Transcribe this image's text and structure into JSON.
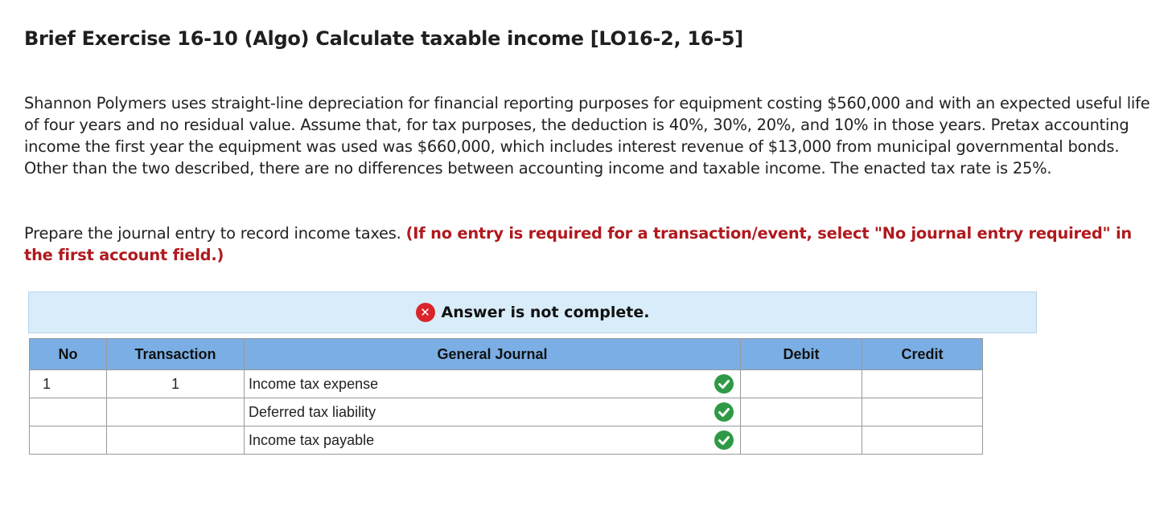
{
  "title": "Brief Exercise 16-10 (Algo) Calculate taxable income [LO16-2, 16-5]",
  "problem_text": "Shannon Polymers uses straight-line depreciation for financial reporting purposes for equipment costing $560,000 and with an expected useful life of four years and no residual value. Assume that, for tax purposes, the deduction is 40%, 30%, 20%, and 10% in those years. Pretax accounting income the first year the equipment was used was $660,000, which includes interest revenue of $13,000 from municipal governmental bonds. Other than the two described, there are no differences between accounting income and taxable income. The enacted tax rate is 25%.",
  "instruction": {
    "text": "Prepare the journal entry to record income taxes.",
    "hint": "(If no entry is required for a transaction/event, select \"No journal entry required\" in the first account field.)"
  },
  "banner": {
    "icon": "x-circle-icon",
    "message": "Answer is not complete."
  },
  "table": {
    "headers": {
      "no": "No",
      "transaction": "Transaction",
      "general_journal": "General Journal",
      "debit": "Debit",
      "credit": "Credit"
    },
    "rows": [
      {
        "no": "1",
        "transaction": "1",
        "account": "Income tax expense",
        "status_icon": "check-icon",
        "debit": "",
        "credit": ""
      },
      {
        "no": "",
        "transaction": "",
        "account": "Deferred tax liability",
        "status_icon": "check-icon",
        "debit": "",
        "credit": ""
      },
      {
        "no": "",
        "transaction": "",
        "account": "Income tax payable",
        "status_icon": "check-icon",
        "debit": "",
        "credit": ""
      }
    ]
  },
  "colors": {
    "hint_red": "#b0191e",
    "banner_bg": "#d9ecf9",
    "header_bg": "#7aaee4",
    "error_red": "#d9252a",
    "check_green": "#2f9a46"
  }
}
